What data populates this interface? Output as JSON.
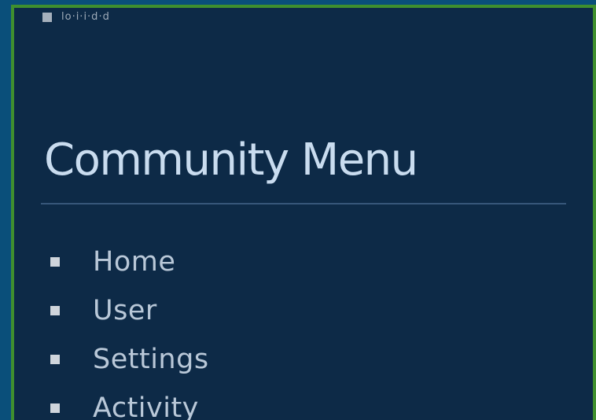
{
  "header": {
    "fragment_text": "lo·i·i·d·d"
  },
  "menu": {
    "title": "Community Menu",
    "items": [
      {
        "label": "Home"
      },
      {
        "label": "User"
      },
      {
        "label": "Settings"
      },
      {
        "label": "Activity"
      }
    ]
  },
  "colors": {
    "page_background": "#0a4f7a",
    "panel_background": "#0d2a47",
    "panel_border": "#3f8f2e",
    "title_text": "#c9dcef",
    "item_text": "#b9c8d8",
    "divider": "#37577a",
    "bullet": "#cfd5dc"
  }
}
